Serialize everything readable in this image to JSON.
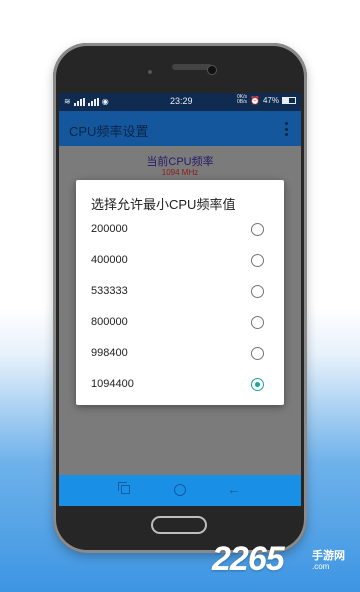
{
  "status_bar": {
    "time": "23:29",
    "net_speed_top": "0K/s",
    "net_speed_bottom": "0B/s",
    "battery": "47%",
    "battery_level": 0.47
  },
  "app_bar": {
    "title": "CPU频率设置",
    "overflow_icon": "more-vertical-icon"
  },
  "content": {
    "current_freq_label": "当前CPU频率",
    "current_freq_value": "1094 MHz"
  },
  "dialog": {
    "title": "选择允许最小CPU频率值",
    "options": [
      {
        "label": "200000",
        "selected": false
      },
      {
        "label": "400000",
        "selected": false
      },
      {
        "label": "533333",
        "selected": false
      },
      {
        "label": "800000",
        "selected": false
      },
      {
        "label": "998400",
        "selected": false
      },
      {
        "label": "1094400",
        "selected": true
      }
    ],
    "accent_color": "#1aa599"
  },
  "nav_bar": {
    "icons": [
      "recent-apps-icon",
      "home-icon",
      "back-icon"
    ]
  },
  "watermark": {
    "brand": "2265",
    "sub_top": "手游网",
    "sub_bottom": ".com"
  },
  "colors": {
    "app_bar": "#15579d",
    "nav_bar": "#1a8fe6",
    "status_bar": "#0f2b50"
  }
}
